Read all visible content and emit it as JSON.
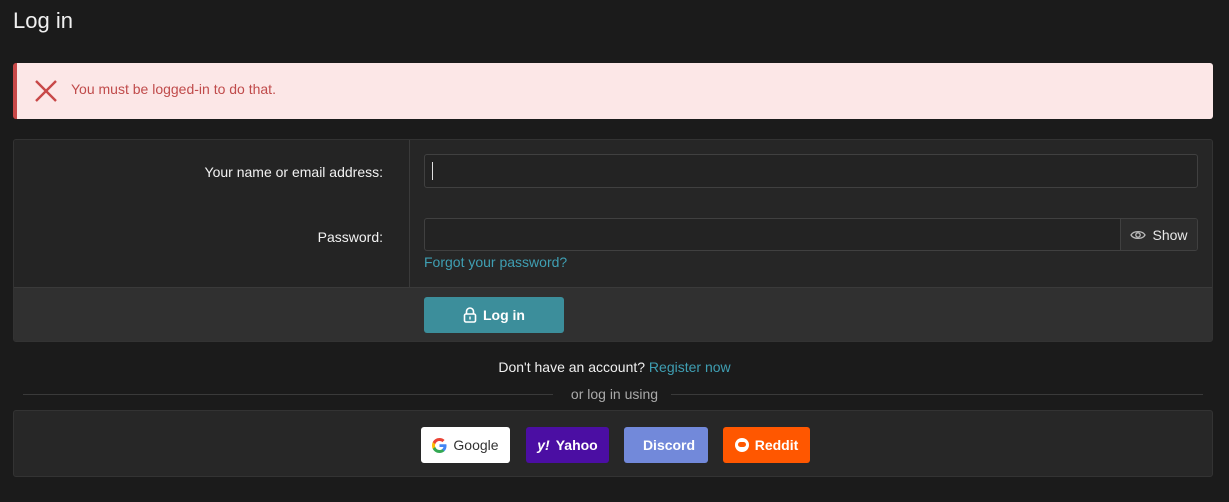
{
  "page": {
    "title": "Log in"
  },
  "alert": {
    "message": "You must be logged-in to do that.",
    "icon": "close-icon",
    "color": "#c84848"
  },
  "form": {
    "username_label": "Your name or email address:",
    "username_value": "",
    "password_label": "Password:",
    "password_value": "",
    "show_label": "Show",
    "forgot_label": "Forgot your password?",
    "login_label": "Log in",
    "accent_color": "#3c8e9b",
    "link_color": "#3f9fb3"
  },
  "register": {
    "prompt": "Don't have an account?",
    "link_label": "Register now"
  },
  "social": {
    "divider_label": "or log in using",
    "buttons": [
      {
        "label": "Google",
        "icon": "google-icon",
        "color": "#ffffff"
      },
      {
        "label": "Yahoo",
        "icon": "yahoo-icon",
        "color": "#4b0ea3"
      },
      {
        "label": "Discord",
        "icon": "discord-icon",
        "color": "#7289da"
      },
      {
        "label": "Reddit",
        "icon": "reddit-icon",
        "color": "#ff5700"
      }
    ]
  }
}
